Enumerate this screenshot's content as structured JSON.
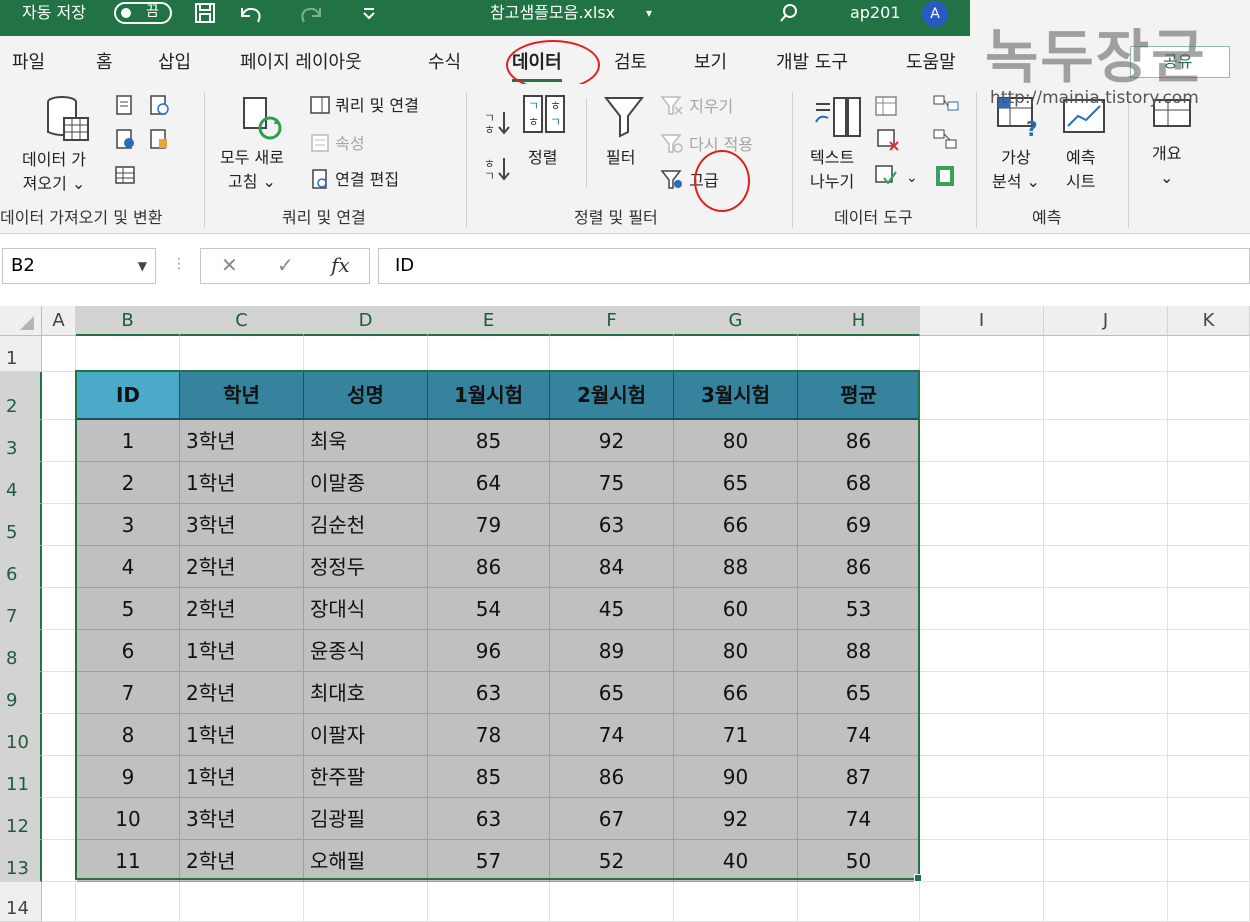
{
  "titlebar": {
    "autosave_label": "자동 저장",
    "autosave_state": "끔",
    "filename": "참고샘플모음.xlsx",
    "user": "ap201",
    "avatar": "A"
  },
  "tabs": [
    "파일",
    "홈",
    "삽입",
    "페이지 레이아웃",
    "수식",
    "데이터",
    "검토",
    "보기",
    "개발 도구",
    "도움말"
  ],
  "active_tab": "데이터",
  "share_label": "공유",
  "ribbon": {
    "get_data": {
      "line1": "데이터 가",
      "line2": "져오기 ⌄",
      "group": "데이터 가져오기 및 변환"
    },
    "queries": {
      "refresh1": "모두 새로",
      "refresh2": "고침 ⌄",
      "queries_connections": "쿼리 및 연결",
      "properties": "속성",
      "edit_links": "연결 편집",
      "group": "쿼리 및 연결"
    },
    "sort_filter": {
      "sort": "정렬",
      "filter": "필터",
      "clear": "지우기",
      "reapply": "다시 적용",
      "advanced": "고급",
      "group": "정렬 및 필터"
    },
    "data_tools": {
      "ttc1": "텍스트",
      "ttc2": "나누기",
      "group": "데이터 도구"
    },
    "forecast": {
      "whatif1": "가상",
      "whatif2": "분석 ⌄",
      "sheet1": "예측",
      "sheet2": "시트",
      "group": "예측"
    },
    "outline": {
      "label": "개요"
    }
  },
  "watermark": {
    "text": "녹두장군",
    "url": "http://mainia.tistory.com"
  },
  "formula_bar": {
    "name_box": "B2",
    "cancel": "✕",
    "enter": "✓",
    "fx": "fx",
    "content": "ID"
  },
  "columns": [
    "A",
    "B",
    "C",
    "D",
    "E",
    "F",
    "G",
    "H",
    "I",
    "J",
    "K"
  ],
  "rows": [
    "1",
    "2",
    "3",
    "4",
    "5",
    "6",
    "7",
    "8",
    "9",
    "10",
    "11",
    "12",
    "13",
    "14"
  ],
  "table": {
    "headers": [
      "ID",
      "학년",
      "성명",
      "1월시험",
      "2월시험",
      "3월시험",
      "평균"
    ],
    "rows": [
      [
        "1",
        "3학년",
        "최욱",
        "85",
        "92",
        "80",
        "86"
      ],
      [
        "2",
        "1학년",
        "이말종",
        "64",
        "75",
        "65",
        "68"
      ],
      [
        "3",
        "3학년",
        "김순천",
        "79",
        "63",
        "66",
        "69"
      ],
      [
        "4",
        "2학년",
        "정정두",
        "86",
        "84",
        "88",
        "86"
      ],
      [
        "5",
        "2학년",
        "장대식",
        "54",
        "45",
        "60",
        "53"
      ],
      [
        "6",
        "1학년",
        "윤종식",
        "96",
        "89",
        "80",
        "88"
      ],
      [
        "7",
        "2학년",
        "최대호",
        "63",
        "65",
        "66",
        "65"
      ],
      [
        "8",
        "1학년",
        "이팔자",
        "78",
        "74",
        "71",
        "74"
      ],
      [
        "9",
        "1학년",
        "한주팔",
        "85",
        "86",
        "90",
        "87"
      ],
      [
        "10",
        "3학년",
        "김광필",
        "63",
        "67",
        "92",
        "74"
      ],
      [
        "11",
        "2학년",
        "오해필",
        "57",
        "52",
        "40",
        "50"
      ]
    ]
  },
  "colors": {
    "accent": "#217346",
    "header_fill": "#36839d",
    "id_header_fill": "#4aaac8",
    "body_fill": "#c0c0c0",
    "annotation": "#e02020"
  }
}
